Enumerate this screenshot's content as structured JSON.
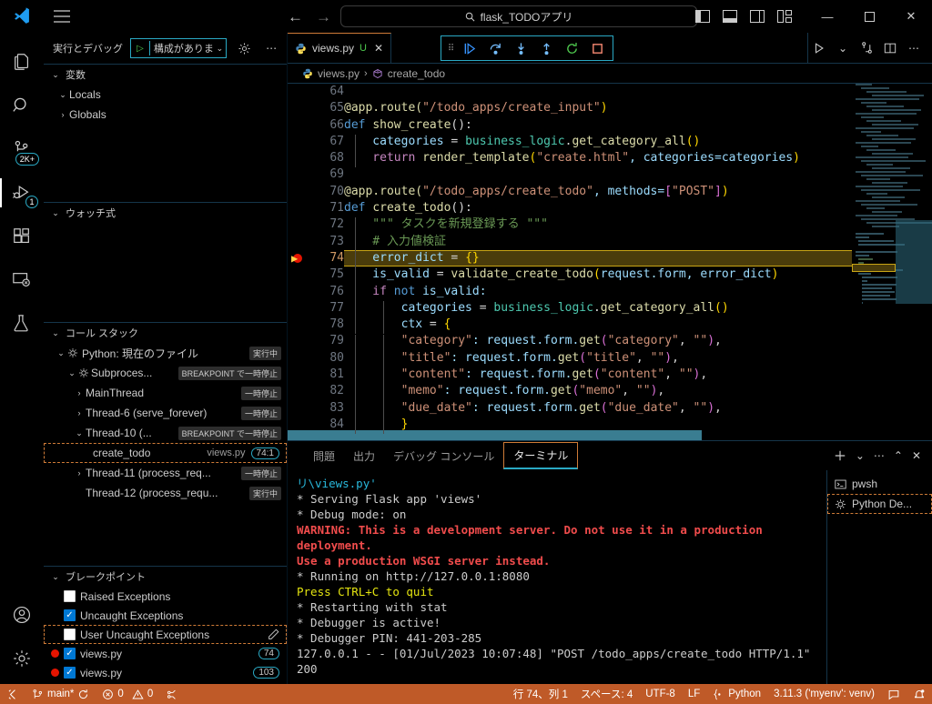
{
  "titlebar": {
    "search_text": "flask_TODOアプリ",
    "back_label": "←",
    "forward_label": "→",
    "minimize": "—",
    "maximize": "▢",
    "close": "✕"
  },
  "activitybar": {
    "items": [
      {
        "name": "explorer",
        "icon": "files-icon",
        "badge": ""
      },
      {
        "name": "search",
        "icon": "search-icon",
        "badge": ""
      },
      {
        "name": "source-control",
        "icon": "source-control-icon",
        "badge": "2K+"
      },
      {
        "name": "run-and-debug",
        "icon": "run-debug-icon",
        "badge": "1",
        "active": true
      },
      {
        "name": "extensions",
        "icon": "extensions-icon",
        "badge": ""
      },
      {
        "name": "remote-explorer",
        "icon": "remote-explorer-icon",
        "badge": ""
      },
      {
        "name": "testing",
        "icon": "testing-flask-icon",
        "badge": ""
      }
    ],
    "bottom": [
      {
        "name": "accounts",
        "icon": "account-icon"
      },
      {
        "name": "manage",
        "icon": "gear-icon"
      }
    ]
  },
  "sidebar": {
    "title": "実行とデバッグ",
    "launch_config": "構成がありま",
    "sections": {
      "variables": {
        "title": "変数",
        "items": [
          {
            "label": "Locals",
            "expanded": true
          },
          {
            "label": "Globals",
            "expanded": false
          }
        ]
      },
      "watch": {
        "title": "ウォッチ式",
        "items": []
      },
      "callstack": {
        "title": "コール スタック",
        "rows": [
          {
            "label": "Python: 現在のファイル",
            "state": "実行中",
            "depth": 1,
            "expanded": true,
            "icon": "debug-session-icon"
          },
          {
            "label": "Subproces...",
            "state": "BREAKPOINT で一時停止",
            "depth": 2,
            "expanded": true,
            "icon": "debug-session-icon"
          },
          {
            "label": "MainThread",
            "state": "一時停止",
            "depth": 3,
            "expanded": false
          },
          {
            "label": "Thread-6 (serve_forever)",
            "state": "一時停止",
            "depth": 3,
            "expanded": false
          },
          {
            "label": "Thread-10 (...",
            "state": "BREAKPOINT で一時停止",
            "depth": 3,
            "expanded": true
          },
          {
            "label": "create_todo",
            "file": "views.py",
            "position": "74:1",
            "depth": 4,
            "selected": true
          },
          {
            "label": "Thread-11 (process_req...",
            "state": "一時停止",
            "depth": 3,
            "expanded": false
          },
          {
            "label": "Thread-12 (process_requ...",
            "state": "実行中",
            "depth": 3
          }
        ]
      },
      "breakpoints": {
        "title": "ブレークポイント",
        "rows": [
          {
            "label": "Raised Exceptions",
            "checked": false,
            "type": "exception"
          },
          {
            "label": "Uncaught Exceptions",
            "checked": true,
            "type": "exception"
          },
          {
            "label": "User Uncaught Exceptions",
            "checked": false,
            "type": "exception",
            "selected": true,
            "edit_icon": "pencil-icon"
          },
          {
            "label": "views.py",
            "checked": true,
            "type": "file",
            "line": "74"
          },
          {
            "label": "views.py",
            "checked": true,
            "type": "file",
            "line": "103"
          }
        ]
      }
    }
  },
  "editor": {
    "tab": {
      "filename": "views.py",
      "dirty_marker": "U",
      "close": "✕",
      "icon": "python-file-icon"
    },
    "debug_toolbar": [
      {
        "name": "continue",
        "icon": "continue-icon"
      },
      {
        "name": "step-over",
        "icon": "step-over-icon"
      },
      {
        "name": "step-into",
        "icon": "step-into-icon"
      },
      {
        "name": "step-out",
        "icon": "step-out-icon"
      },
      {
        "name": "restart",
        "icon": "restart-icon"
      },
      {
        "name": "stop",
        "icon": "stop-icon"
      }
    ],
    "breadcrumbs": [
      {
        "label": "views.py",
        "icon": "python-file-icon"
      },
      {
        "label": "create_todo",
        "icon": "symbol-method-icon"
      }
    ],
    "actions": [
      {
        "name": "run-python-file",
        "icon": "play-icon"
      },
      {
        "name": "run-dropdown",
        "icon": "chevron-down-icon"
      },
      {
        "name": "split-terminal-source",
        "icon": "source-control-icon"
      },
      {
        "name": "split-editor",
        "icon": "split-editor-icon"
      },
      {
        "name": "more-actions",
        "icon": "ellipsis-icon"
      }
    ],
    "current_line": 74,
    "breakpoint_lines": [
      74
    ],
    "lines": [
      {
        "n": 64,
        "tokens": []
      },
      {
        "n": 65,
        "tokens": [
          {
            "t": "@app.route(",
            "c": "fn"
          },
          {
            "t": "\"/todo_apps/create_input\"",
            "c": "st"
          },
          {
            "t": ")",
            "c": "br1"
          }
        ]
      },
      {
        "n": 66,
        "tokens": [
          {
            "t": "def ",
            "c": "k"
          },
          {
            "t": "show_create",
            "c": "fn"
          },
          {
            "t": "():",
            "c": "op"
          }
        ]
      },
      {
        "n": 67,
        "indent": 1,
        "tokens": [
          {
            "t": "    categories ",
            "c": "va"
          },
          {
            "t": "= ",
            "c": "op"
          },
          {
            "t": "business_logic",
            "c": "ty"
          },
          {
            "t": ".",
            "c": "op"
          },
          {
            "t": "get_category_all",
            "c": "fn"
          },
          {
            "t": "()",
            "c": "br1"
          }
        ]
      },
      {
        "n": 68,
        "indent": 1,
        "tokens": [
          {
            "t": "    return ",
            "c": "kw"
          },
          {
            "t": "render_template",
            "c": "fn"
          },
          {
            "t": "(",
            "c": "br1"
          },
          {
            "t": "\"create.html\"",
            "c": "st"
          },
          {
            "t": ", categories=categories",
            "c": "va"
          },
          {
            "t": ")",
            "c": "br1"
          }
        ]
      },
      {
        "n": 69,
        "tokens": []
      },
      {
        "n": 70,
        "tokens": [
          {
            "t": "@app.route(",
            "c": "fn"
          },
          {
            "t": "\"/todo_apps/create_todo\"",
            "c": "st"
          },
          {
            "t": ", methods=",
            "c": "va"
          },
          {
            "t": "[",
            "c": "br2"
          },
          {
            "t": "\"POST\"",
            "c": "st"
          },
          {
            "t": "]",
            "c": "br2"
          },
          {
            "t": ")",
            "c": "br1"
          }
        ]
      },
      {
        "n": 71,
        "tokens": [
          {
            "t": "def ",
            "c": "k"
          },
          {
            "t": "create_todo",
            "c": "fn"
          },
          {
            "t": "():",
            "c": "op"
          }
        ]
      },
      {
        "n": 72,
        "indent": 1,
        "tokens": [
          {
            "t": "    \"\"\" タスクを新規登録する \"\"\"",
            "c": "cm"
          }
        ]
      },
      {
        "n": 73,
        "indent": 1,
        "tokens": [
          {
            "t": "    # 入力値検証",
            "c": "cm"
          }
        ]
      },
      {
        "n": 74,
        "indent": 1,
        "current": true,
        "breakpoint": true,
        "tokens": [
          {
            "t": "    error_dict ",
            "c": "va"
          },
          {
            "t": "= ",
            "c": "op"
          },
          {
            "t": "{}",
            "c": "br1"
          }
        ]
      },
      {
        "n": 75,
        "indent": 1,
        "tokens": [
          {
            "t": "    is_valid ",
            "c": "va"
          },
          {
            "t": "= ",
            "c": "op"
          },
          {
            "t": "validate_create_todo",
            "c": "fn"
          },
          {
            "t": "(",
            "c": "br1"
          },
          {
            "t": "request.form, error_dict",
            "c": "va"
          },
          {
            "t": ")",
            "c": "br1"
          }
        ]
      },
      {
        "n": 76,
        "indent": 1,
        "tokens": [
          {
            "t": "    if ",
            "c": "kw"
          },
          {
            "t": "not ",
            "c": "k"
          },
          {
            "t": "is_valid:",
            "c": "va"
          }
        ]
      },
      {
        "n": 77,
        "indent": 2,
        "tokens": [
          {
            "t": "        categories ",
            "c": "va"
          },
          {
            "t": "= ",
            "c": "op"
          },
          {
            "t": "business_logic",
            "c": "ty"
          },
          {
            "t": ".",
            "c": "op"
          },
          {
            "t": "get_category_all",
            "c": "fn"
          },
          {
            "t": "()",
            "c": "br1"
          }
        ]
      },
      {
        "n": 78,
        "indent": 2,
        "tokens": [
          {
            "t": "        ctx ",
            "c": "va"
          },
          {
            "t": "= ",
            "c": "op"
          },
          {
            "t": "{",
            "c": "br1"
          }
        ]
      },
      {
        "n": 79,
        "indent": 2,
        "tokens": [
          {
            "t": "        \"category\"",
            "c": "st"
          },
          {
            "t": ": request.form.",
            "c": "va"
          },
          {
            "t": "get",
            "c": "fn"
          },
          {
            "t": "(",
            "c": "br2"
          },
          {
            "t": "\"category\"",
            "c": "st"
          },
          {
            "t": ", ",
            "c": "op"
          },
          {
            "t": "\"\"",
            "c": "st"
          },
          {
            "t": ")",
            "c": "br2"
          },
          {
            "t": ",",
            "c": "op"
          }
        ]
      },
      {
        "n": 80,
        "indent": 2,
        "tokens": [
          {
            "t": "        \"title\"",
            "c": "st"
          },
          {
            "t": ": request.form.",
            "c": "va"
          },
          {
            "t": "get",
            "c": "fn"
          },
          {
            "t": "(",
            "c": "br2"
          },
          {
            "t": "\"title\"",
            "c": "st"
          },
          {
            "t": ", ",
            "c": "op"
          },
          {
            "t": "\"\"",
            "c": "st"
          },
          {
            "t": ")",
            "c": "br2"
          },
          {
            "t": ",",
            "c": "op"
          }
        ]
      },
      {
        "n": 81,
        "indent": 2,
        "tokens": [
          {
            "t": "        \"content\"",
            "c": "st"
          },
          {
            "t": ": request.form.",
            "c": "va"
          },
          {
            "t": "get",
            "c": "fn"
          },
          {
            "t": "(",
            "c": "br2"
          },
          {
            "t": "\"content\"",
            "c": "st"
          },
          {
            "t": ", ",
            "c": "op"
          },
          {
            "t": "\"\"",
            "c": "st"
          },
          {
            "t": ")",
            "c": "br2"
          },
          {
            "t": ",",
            "c": "op"
          }
        ]
      },
      {
        "n": 82,
        "indent": 2,
        "tokens": [
          {
            "t": "        \"memo\"",
            "c": "st"
          },
          {
            "t": ": request.form.",
            "c": "va"
          },
          {
            "t": "get",
            "c": "fn"
          },
          {
            "t": "(",
            "c": "br2"
          },
          {
            "t": "\"memo\"",
            "c": "st"
          },
          {
            "t": ", ",
            "c": "op"
          },
          {
            "t": "\"\"",
            "c": "st"
          },
          {
            "t": ")",
            "c": "br2"
          },
          {
            "t": ",",
            "c": "op"
          }
        ]
      },
      {
        "n": 83,
        "indent": 2,
        "tokens": [
          {
            "t": "        \"due_date\"",
            "c": "st"
          },
          {
            "t": ": request.form.",
            "c": "va"
          },
          {
            "t": "get",
            "c": "fn"
          },
          {
            "t": "(",
            "c": "br2"
          },
          {
            "t": "\"due_date\"",
            "c": "st"
          },
          {
            "t": ", ",
            "c": "op"
          },
          {
            "t": "\"\"",
            "c": "st"
          },
          {
            "t": ")",
            "c": "br2"
          },
          {
            "t": ",",
            "c": "op"
          }
        ]
      },
      {
        "n": 84,
        "indent": 2,
        "tokens": [
          {
            "t": "        }",
            "c": "br1"
          }
        ]
      }
    ]
  },
  "panel": {
    "tabs": [
      {
        "label": "問題",
        "active": false
      },
      {
        "label": "出力",
        "active": false
      },
      {
        "label": "デバッグ コンソール",
        "active": false
      },
      {
        "label": "ターミナル",
        "active": true
      }
    ],
    "actions": [
      {
        "name": "new-terminal",
        "icon": "plus-icon"
      },
      {
        "name": "terminal-dropdown",
        "icon": "chevron-down-icon"
      },
      {
        "name": "panel-more",
        "icon": "ellipsis-icon"
      },
      {
        "name": "maximize-panel",
        "icon": "chevron-up-icon"
      },
      {
        "name": "close-panel",
        "icon": "close-icon"
      }
    ],
    "terminal_lines": [
      {
        "text": "リ\\views.py'",
        "color": "cyan"
      },
      {
        "text": " * Serving Flask app 'views'",
        "color": "white"
      },
      {
        "text": " * Debug mode: on",
        "color": "white"
      },
      {
        "text": "WARNING: This is a development server. Do not use it in a production deployment.",
        "color": "red"
      },
      {
        "text": " Use a production WSGI server instead.",
        "color": "red"
      },
      {
        "text": " * Running on http://127.0.0.1:8080",
        "color": "white"
      },
      {
        "text": "Press CTRL+C to quit",
        "color": "yellow"
      },
      {
        "text": " * Restarting with stat",
        "color": "white"
      },
      {
        "text": " * Debugger is active!",
        "color": "white"
      },
      {
        "text": " * Debugger PIN: 441-203-285",
        "color": "white"
      },
      {
        "text": "127.0.0.1 - - [01/Jul/2023 10:07:48] \"POST /todo_apps/create_todo HTTP/1.1\" 200",
        "color": "white"
      },
      {
        "text": "-",
        "color": "white"
      }
    ],
    "terminal_list": [
      {
        "label": "pwsh",
        "icon": "terminal-icon",
        "selected": false
      },
      {
        "label": "Python De...",
        "icon": "debug-session-icon",
        "selected": true
      }
    ]
  },
  "statusbar": {
    "remote_label": "",
    "branch": "main*",
    "errors": "0",
    "warnings": "0",
    "cursor_position": "行 74、列 1",
    "indentation": "スペース: 4",
    "encoding": "UTF-8",
    "eol": "LF",
    "language": "Python",
    "interpreter": "3.11.3 ('myenv': venv)"
  }
}
